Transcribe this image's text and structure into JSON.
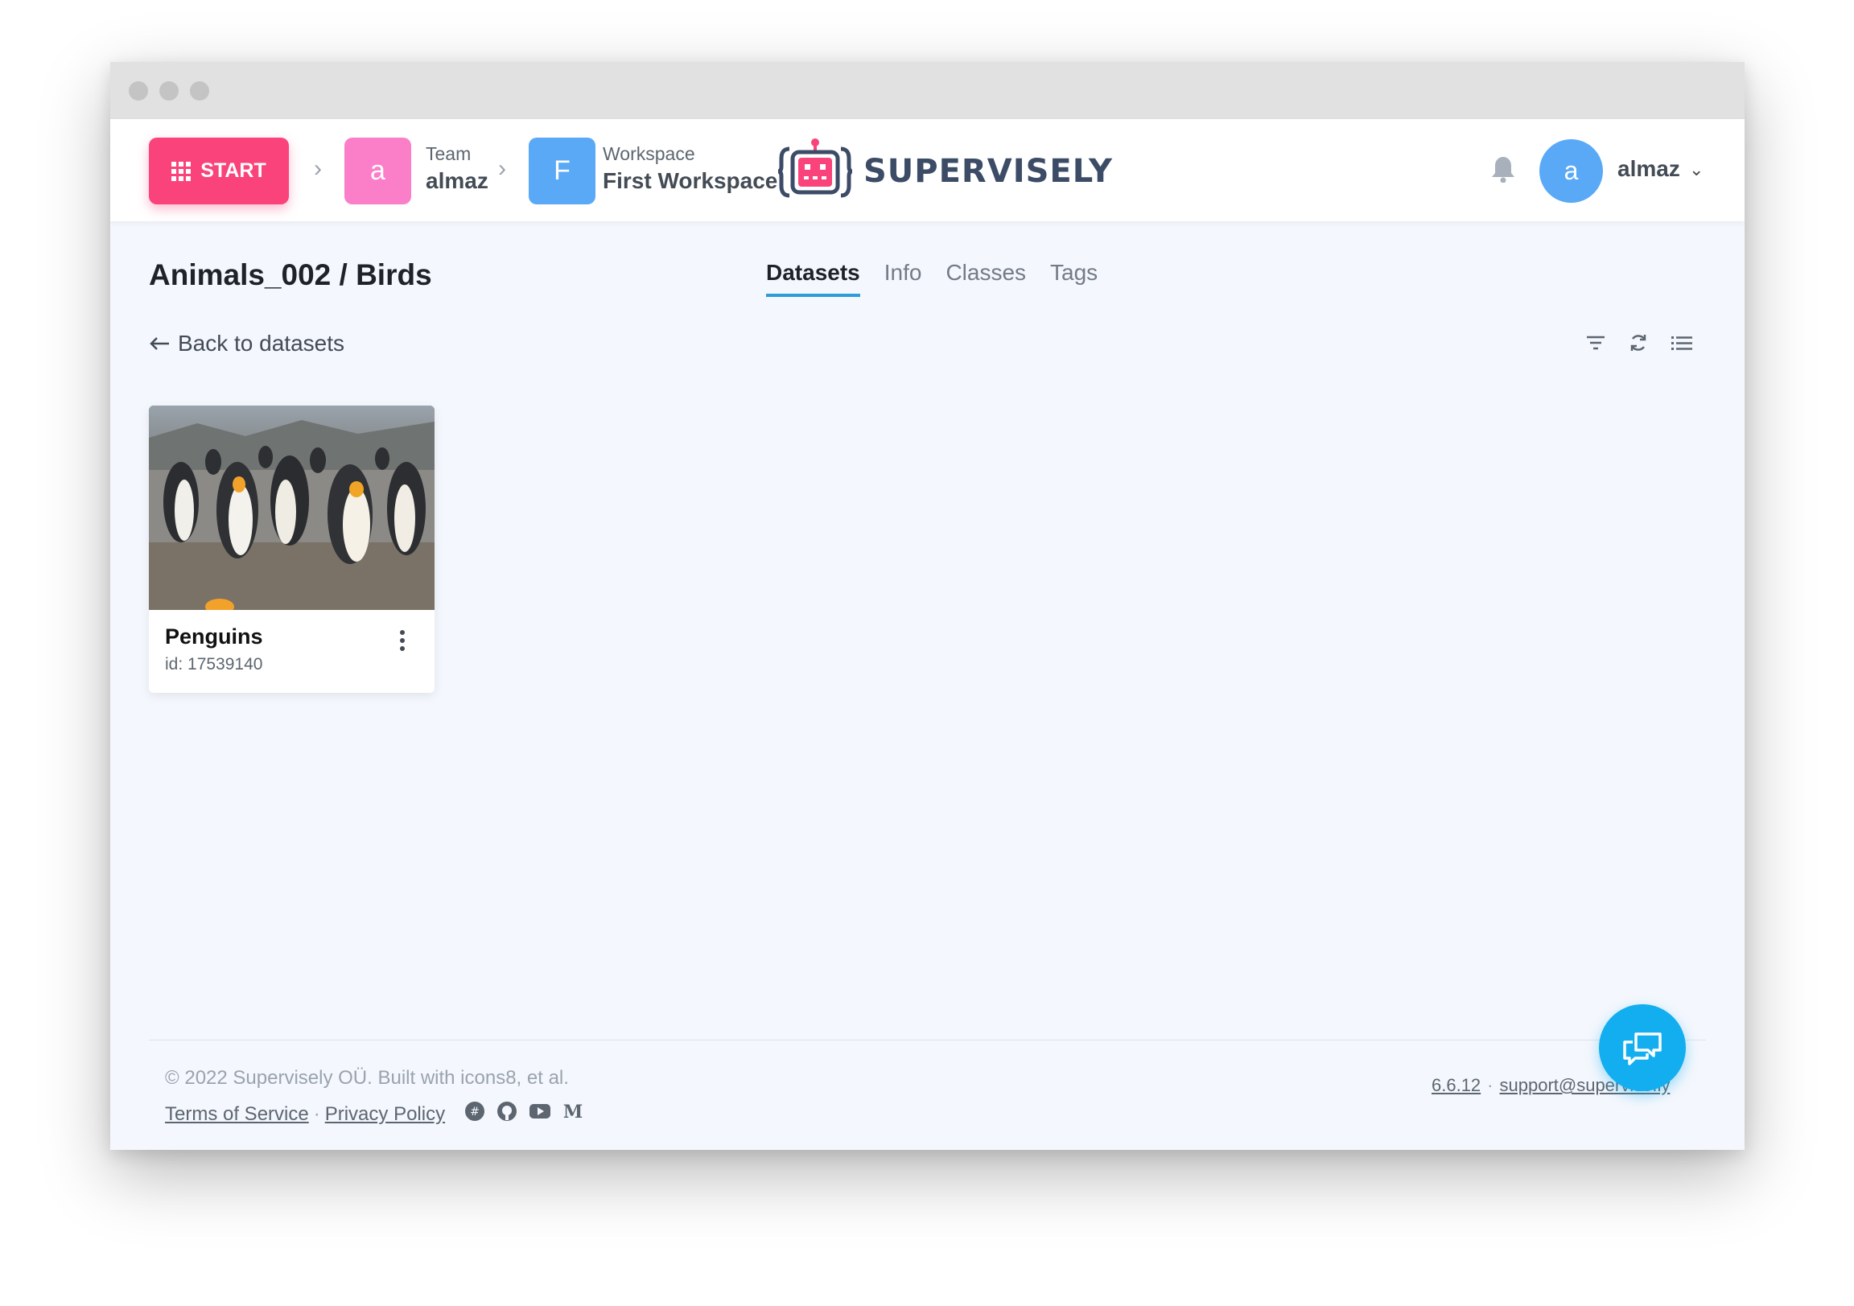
{
  "topbar": {
    "start_label": "START",
    "team": {
      "initial": "a",
      "caption": "Team",
      "name": "almaz",
      "color": "#fb7ec8"
    },
    "workspace": {
      "initial": "F",
      "caption": "Workspace",
      "name": "First Workspace",
      "color": "#5aa9f7"
    },
    "logo_text": "SUPERVISELY",
    "user": {
      "initial": "a",
      "name": "almaz"
    }
  },
  "page": {
    "title": "Animals_002 / Birds",
    "tabs": [
      {
        "label": "Datasets",
        "active": true
      },
      {
        "label": "Info",
        "active": false
      },
      {
        "label": "Classes",
        "active": false
      },
      {
        "label": "Tags",
        "active": false
      }
    ],
    "back_label": "Back to datasets"
  },
  "datasets": [
    {
      "name": "Penguins",
      "id_text": "id: 17539140"
    }
  ],
  "footer": {
    "copyright": "© 2022 Supervisely OÜ. Built with icons8, et al.",
    "terms": "Terms of Service",
    "sep": "·",
    "privacy": "Privacy Policy",
    "version": "6.6.12",
    "support": "support@supervise.ly",
    "social_icons": [
      "slack-icon",
      "github-icon",
      "youtube-icon",
      "medium-icon"
    ]
  },
  "colors": {
    "accent": "#f9437a",
    "tab_underline": "#2d9cdb",
    "chat": "#12aef0"
  }
}
